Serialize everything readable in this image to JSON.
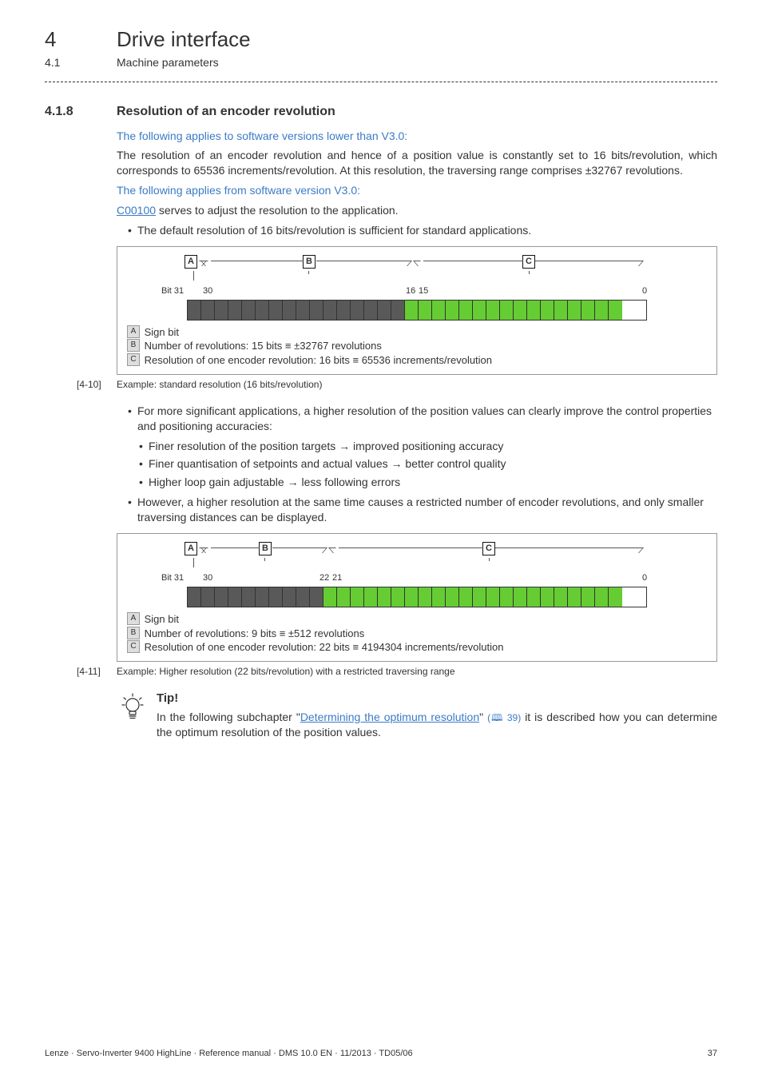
{
  "header": {
    "chapter_num": "4",
    "chapter_title": "Drive interface",
    "sub_num": "4.1",
    "sub_title": "Machine parameters"
  },
  "section": {
    "num": "4.1.8",
    "title": "Resolution of an encoder revolution"
  },
  "intro": {
    "lead1": "The following applies to software versions lower than V3.0:",
    "p1": "The resolution of an encoder revolution and hence of a position value is constantly set to 16 bits/revolution, which corresponds to 65536 increments/revolution. At this resolution, the traversing range comprises ±32767 revolutions.",
    "lead2": "The following applies from software version V3.0:",
    "p2_pre_link": "",
    "p2_link": "C00100",
    "p2_post_link": " serves to adjust the resolution to the application.",
    "bullet1": "The default resolution of 16 bits/revolution is sufficient for standard applications."
  },
  "fig1": {
    "bit_label_left": "Bit 31",
    "bit_label_mid_left": "30",
    "bit_label_mid_right_a": "16",
    "bit_label_mid_right_b": "15",
    "bit_label_right": "0",
    "note_a": " Sign bit",
    "note_b": " Number of revolutions: 15 bits ≡ ±32767 revolutions",
    "note_c": " Resolution of one encoder revolution: 16 bits ≡ 65536 increments/revolution",
    "caption_label": "[4-10]",
    "caption_text": "Example: standard resolution (16 bits/revolution)"
  },
  "mid_bullets": {
    "b1": "For more significant applications, a higher resolution of the position values can clearly improve the control properties and positioning accuracies:",
    "b1a": "Finer resolution of the position targets → improved positioning accuracy",
    "b1b": "Finer quantisation of setpoints and actual values → better control quality",
    "b1c": "Higher loop gain adjustable → less following errors",
    "b2": "However, a higher resolution at the same time causes a restricted number of encoder revolutions, and only smaller traversing distances can be displayed."
  },
  "fig2": {
    "bit_label_left": "Bit 31",
    "bit_label_mid_left": "30",
    "bit_label_mid_right_a": "22",
    "bit_label_mid_right_b": "21",
    "bit_label_right": "0",
    "note_a": " Sign bit",
    "note_b": " Number of revolutions: 9 bits ≡ ±512 revolutions",
    "note_c": " Resolution of one encoder revolution: 22 bits ≡ 4194304 increments/revolution",
    "caption_label": "[4-11]",
    "caption_text": "Example: Higher resolution (22 bits/revolution) with a restricted traversing range"
  },
  "tip": {
    "title": "Tip!",
    "pre": "In the following subchapter \"",
    "link": "Determining the optimum resolution",
    "mid": "\" ",
    "pageref": "(🕮 39)",
    "post": " it is described how you can determine the optimum resolution of the position values."
  },
  "footer": {
    "left": "Lenze · Servo-Inverter 9400 HighLine · Reference manual · DMS 10.0 EN · 11/2013 · TD05/06",
    "page": "37"
  },
  "labels": {
    "A": "A",
    "B": "B",
    "C": "C"
  },
  "chart_data": [
    {
      "type": "bitfield",
      "total_bits": 32,
      "layout": "MSB=bit31 left, LSB=bit0 right",
      "fields": [
        {
          "label": "A",
          "name": "Sign bit",
          "bits": "31",
          "width": 1,
          "color": "grey"
        },
        {
          "label": "B",
          "name": "Number of revolutions",
          "bits": "30..16",
          "width": 15,
          "color": "grey",
          "value_range": "±32767 revolutions"
        },
        {
          "label": "C",
          "name": "Resolution of one encoder revolution",
          "bits": "15..0",
          "width": 16,
          "color": "green",
          "increments": 65536
        }
      ],
      "tick_labels": [
        "Bit 31",
        "30",
        "16",
        "15",
        "0"
      ]
    },
    {
      "type": "bitfield",
      "total_bits": 32,
      "layout": "MSB=bit31 left, LSB=bit0 right",
      "fields": [
        {
          "label": "A",
          "name": "Sign bit",
          "bits": "31",
          "width": 1,
          "color": "grey"
        },
        {
          "label": "B",
          "name": "Number of revolutions",
          "bits": "30..22",
          "width": 9,
          "color": "grey",
          "value_range": "±512 revolutions"
        },
        {
          "label": "C",
          "name": "Resolution of one encoder revolution",
          "bits": "21..0",
          "width": 22,
          "color": "green",
          "increments": 4194304
        }
      ],
      "tick_labels": [
        "Bit 31",
        "30",
        "22",
        "21",
        "0"
      ]
    }
  ]
}
